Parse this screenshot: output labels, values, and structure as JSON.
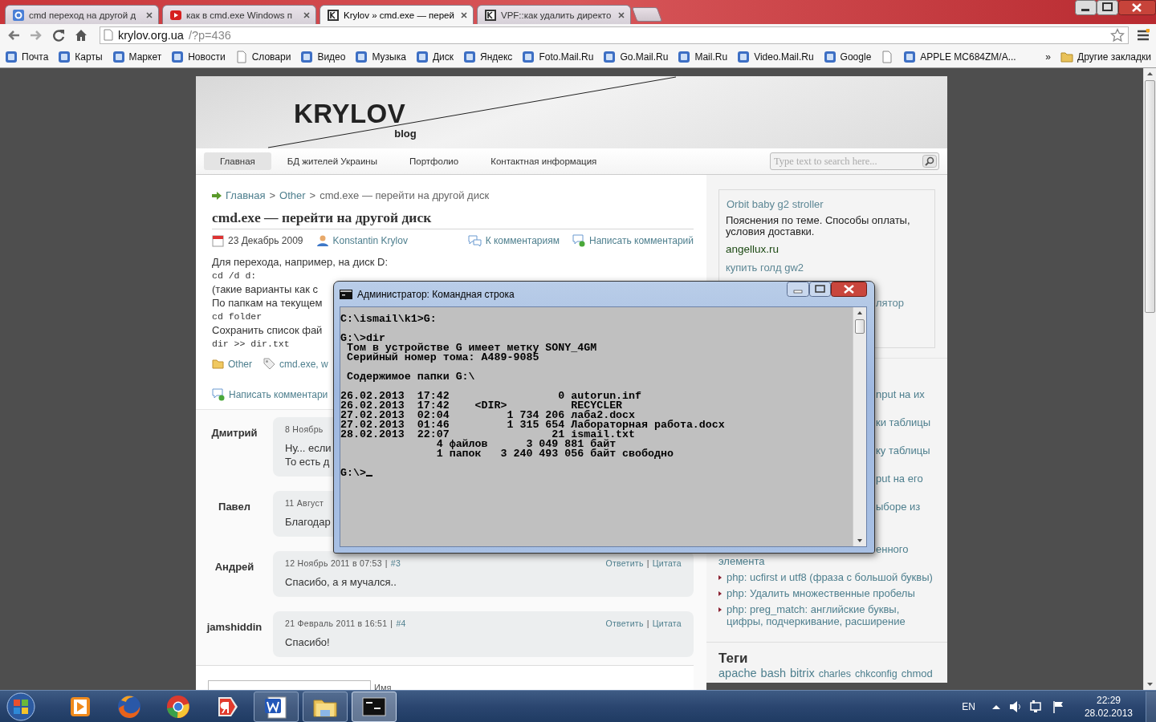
{
  "browser": {
    "tabs": [
      {
        "title": "cmd переход на другой д",
        "selected": false,
        "kind": "search"
      },
      {
        "title": "как в cmd.exe Windows п",
        "selected": false,
        "kind": "video"
      },
      {
        "title": "Krylov » cmd.exe — перей",
        "selected": true,
        "kind": "letter"
      },
      {
        "title": "VPF::как удалить директо",
        "selected": false,
        "kind": "letter"
      }
    ],
    "address": {
      "host": "krylov.org.ua",
      "path": "/?p=436"
    },
    "bookmarks": [
      {
        "label": "Почта",
        "kind": "site"
      },
      {
        "label": "Карты",
        "kind": "site"
      },
      {
        "label": "Маркет",
        "kind": "site"
      },
      {
        "label": "Новости",
        "kind": "site"
      },
      {
        "label": "Словари",
        "kind": "page"
      },
      {
        "label": "Видео",
        "kind": "site"
      },
      {
        "label": "Музыка",
        "kind": "site"
      },
      {
        "label": "Диск",
        "kind": "site"
      },
      {
        "label": "Яндекс",
        "kind": "site"
      },
      {
        "label": "Foto.Mail.Ru",
        "kind": "site"
      },
      {
        "label": "Go.Mail.Ru",
        "kind": "site"
      },
      {
        "label": "Mail.Ru",
        "kind": "site"
      },
      {
        "label": "Video.Mail.Ru",
        "kind": "site"
      },
      {
        "label": "Google",
        "kind": "site"
      },
      {
        "kind": "page"
      },
      {
        "label": "APPLE MC684ZM/A...",
        "kind": "site"
      }
    ],
    "overflow": "»",
    "other_bookmarks": "Другие закладки"
  },
  "blog": {
    "logo": "KRYLOV",
    "tagline": "blog",
    "nav": [
      {
        "label": "Главная",
        "selected": true
      },
      {
        "label": "БД жителей Украины",
        "selected": false
      },
      {
        "label": "Портфолио",
        "selected": false
      },
      {
        "label": "Контактная информация",
        "selected": false
      }
    ],
    "search": {
      "placeholder": "Type text to search here..."
    },
    "breadcrumb": [
      "Главная",
      "Other",
      "cmd.exe — перейти на другой диск"
    ],
    "breadcrumb_separator": ">",
    "post": {
      "title": "cmd.exe — перейти на другой диск",
      "date": "23 Декабрь 2009",
      "author": "Konstantin Krylov",
      "comments_link": "К комментариям",
      "write_link": "Написать комментарий",
      "body": [
        {
          "kind": "text",
          "text": "Для перехода, например, на диск D:"
        },
        {
          "kind": "code",
          "text": "cd /d d:"
        },
        {
          "kind": "text",
          "text": "(такие варианты как с"
        },
        {
          "kind": "text",
          "text": "По папкам на текущем"
        },
        {
          "kind": "code",
          "text": "cd folder"
        },
        {
          "kind": "text",
          "text": "Сохранить список фай"
        },
        {
          "kind": "code",
          "text": "dir >> dir.txt"
        }
      ],
      "category": "Other",
      "tags": "cmd.exe, w",
      "write_link_bottom": "Написать комментари"
    },
    "comments": [
      {
        "author": "Дмитрий",
        "meta": "8 Ноябрь",
        "text": [
          "Ну... если",
          "То есть д"
        ]
      },
      {
        "author": "Павел",
        "meta": "11 Август",
        "text": [
          "Благодар"
        ]
      },
      {
        "author": "Андрей",
        "meta": "12 Ноябрь 2011 в 07:53",
        "number": "#3",
        "actions": [
          "Ответить",
          "Цитата"
        ],
        "text": [
          "Спасибо, а я мучался.."
        ]
      },
      {
        "author": "jamshiddin",
        "meta": "21 Февраль 2011 в 16:51",
        "number": "#4",
        "actions": [
          "Ответить",
          "Цитата"
        ],
        "text": [
          "Спасибо!"
        ]
      }
    ],
    "separator": "|",
    "form": {
      "name_label": "Имя"
    }
  },
  "sidebar": {
    "ad": {
      "title": "Orbit baby g2 stroller",
      "description": "Пояснения по теме. Способы оплаты, условия доставки.",
      "domain": "angellux.ru",
      "links": [
        "купить голд gw2",
        "лятор"
      ]
    },
    "posts": [
      {
        "kind": "fragment",
        "title": "nput на их"
      },
      {
        "kind": "fragment",
        "title": "ки таблицы"
      },
      {
        "kind": "fragment",
        "title": "ку таблицы"
      },
      {
        "kind": "fragment",
        "title": "put на его"
      },
      {
        "kind": "fragment",
        "title": "ыборе из"
      },
      {
        "kind": "fragment",
        "title": "енного"
      },
      {
        "kind": "continuation",
        "title": "элемента"
      },
      {
        "kind": "item",
        "title": "php: ucfirst и utf8 (фраза с большой буквы)"
      },
      {
        "kind": "item",
        "title": "php: Удалить множественные пробелы"
      },
      {
        "kind": "item",
        "title": "php: preg_match: английские буквы, цифры, подчеркивание, расширение"
      }
    ],
    "tags_title": "Теги",
    "tags": [
      "apache",
      "bash",
      "bitrix",
      "charles",
      "chkconfig",
      "chmod"
    ]
  },
  "console": {
    "title": "Администратор: Командная строка",
    "blocks": [
      [
        "C:\\ismail\\k1>G:"
      ],
      [
        "G:\\>dir",
        " Том в устройстве G имеет метку SONY_4GM",
        " Серийный номер тома: A489-9085"
      ],
      [
        " Содержимое папки G:\\"
      ],
      [
        "26.02.2013  17:42                 0 autorun.inf",
        "26.02.2013  17:42    <DIR>          RECYCLER",
        "27.02.2013  02:04         1 734 206 лаба2.docx",
        "27.02.2013  01:46         1 315 654 Лабораторная работа.docx",
        "28.02.2013  22:07                21 ismail.txt",
        "               4 файлов      3 049 881 байт",
        "               1 папок   3 240 493 056 байт свободно"
      ],
      [
        "G:\\>"
      ]
    ]
  },
  "taskbar": {
    "apps": [
      {
        "kind": "media",
        "running": false,
        "selected": false
      },
      {
        "kind": "firefox",
        "running": false,
        "selected": false
      },
      {
        "kind": "chrome",
        "running": false,
        "selected": false
      },
      {
        "kind": "yandex",
        "running": false,
        "selected": false
      },
      {
        "kind": "word",
        "running": true,
        "selected": false
      },
      {
        "kind": "explorer",
        "running": true,
        "selected": false
      },
      {
        "kind": "console",
        "running": true,
        "selected": true
      }
    ],
    "language": "EN",
    "time": "22:29",
    "date": "28.02.2013"
  }
}
